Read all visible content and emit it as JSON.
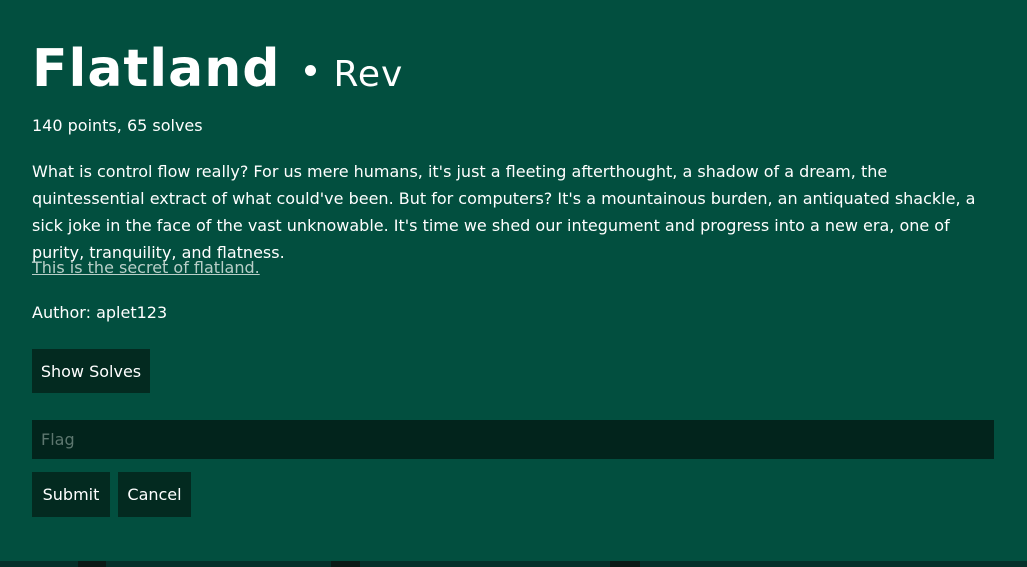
{
  "challenge": {
    "title": "Flatland",
    "category": "Rev",
    "points_solves": "140 points, 65 solves",
    "description": "What is control flow really? For us mere humans, it's just a fleeting afterthought, a shadow of a dream, the quintessential extract of what could've been. But for computers? It's a mountainous burden, an antiquated shackle, a sick joke in the face of the vast unknowable. It's time we shed our integument and progress into a new era, one of purity, tranquility, and flatness.",
    "link_text": "This is the secret of flatland.",
    "author": "Author: aplet123"
  },
  "buttons": {
    "show_solves": "Show Solves",
    "submit": "Submit",
    "cancel": "Cancel"
  },
  "flag_input": {
    "placeholder": "Flag",
    "value": ""
  },
  "colors": {
    "background": "#024f3f",
    "button_bg": "#032a20",
    "input_bg": "#02241c",
    "link": "#b9cfc8"
  }
}
